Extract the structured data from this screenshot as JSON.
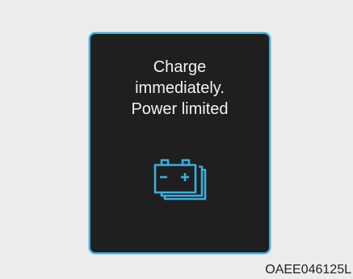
{
  "warning": {
    "lines": [
      "Charge",
      "immediately.",
      "Power limited"
    ],
    "icon": "battery-warning-icon",
    "accent_color": "#3aaede"
  },
  "figure_code": "OAEE046125L"
}
